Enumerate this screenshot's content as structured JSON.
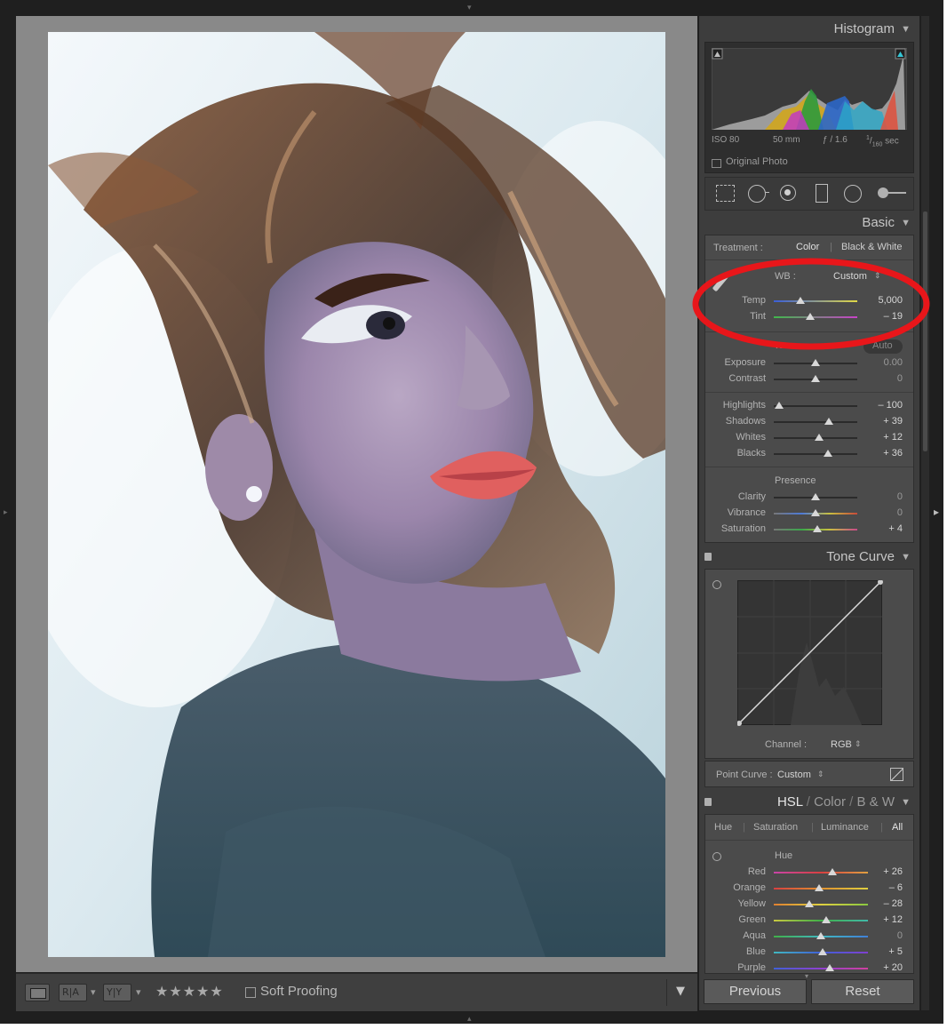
{
  "histogram": {
    "title": "Histogram",
    "iso": "ISO 80",
    "focal": "50 mm",
    "aperture": "ƒ / 1.6",
    "shutter_prefix": "1",
    "shutter_den": "160",
    "shutter_suffix": "sec",
    "original_photo": "Original Photo"
  },
  "basic": {
    "title": "Basic",
    "treatment_label": "Treatment :",
    "treatment_color": "Color",
    "treatment_bw": "Black & White",
    "wb_label": "WB :",
    "wb_value": "Custom",
    "temp_label": "Temp",
    "temp_value": "5,000",
    "temp_level": 0.32,
    "tint_label": "Tint",
    "tint_value": "– 19",
    "tint_level": 0.45,
    "tone_label": "Tone",
    "tone_auto": "Auto",
    "exposure_label": "Exposure",
    "exposure_value": "0.00",
    "contrast_label": "Contrast",
    "contrast_value": "0",
    "highlights_label": "Highlights",
    "highlights_value": "– 100",
    "shadows_label": "Shadows",
    "shadows_value": "+ 39",
    "whites_label": "Whites",
    "whites_value": "+ 12",
    "blacks_label": "Blacks",
    "blacks_value": "+ 36",
    "presence_label": "Presence",
    "clarity_label": "Clarity",
    "clarity_value": "0",
    "vibrance_label": "Vibrance",
    "vibrance_value": "0",
    "saturation_label": "Saturation",
    "saturation_value": "+ 4"
  },
  "tone_curve": {
    "title": "Tone Curve",
    "channel_label": "Channel :",
    "channel_value": "RGB",
    "point_curve_label": "Point Curve :",
    "point_curve_value": "Custom"
  },
  "hsl": {
    "title_hsl": "HSL",
    "title_color": "Color",
    "title_bw": "B & W",
    "tab_hue": "Hue",
    "tab_saturation": "Saturation",
    "tab_luminance": "Luminance",
    "tab_all": "All",
    "section": "Hue",
    "rows": [
      {
        "label": "Red",
        "value": "+ 26"
      },
      {
        "label": "Orange",
        "value": "– 6"
      },
      {
        "label": "Yellow",
        "value": "– 28"
      },
      {
        "label": "Green",
        "value": "+ 12"
      },
      {
        "label": "Aqua",
        "value": "0"
      },
      {
        "label": "Blue",
        "value": "+ 5"
      },
      {
        "label": "Purple",
        "value": "+ 20"
      }
    ]
  },
  "buttons": {
    "previous": "Previous",
    "reset": "Reset"
  },
  "toolbar": {
    "soft_proofing": "Soft Proofing",
    "stars": "★★★★★",
    "ra_label": "R|A",
    "yy_label": "Y|Y"
  },
  "colors": {
    "annotation_red": "#e8161a",
    "panel_bg": "#3d3d3d",
    "canvas_bg": "#898989"
  }
}
